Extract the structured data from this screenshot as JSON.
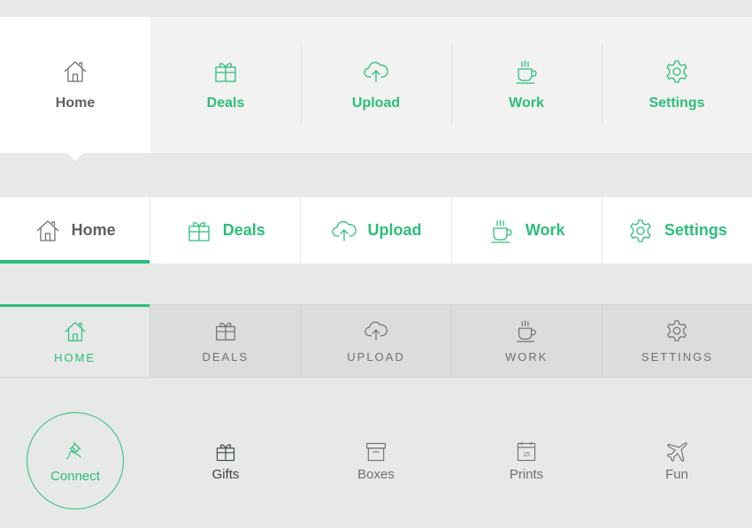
{
  "colors": {
    "accent": "#2ebd7a",
    "text_dark": "#5c6260",
    "text_muted": "#6c7270",
    "background": "#e6e9e8"
  },
  "nav1": {
    "items": [
      {
        "label": "Home",
        "icon": "home-icon",
        "active": true
      },
      {
        "label": "Deals",
        "icon": "gift-icon"
      },
      {
        "label": "Upload",
        "icon": "cloud-upload-icon"
      },
      {
        "label": "Work",
        "icon": "coffee-cup-icon"
      },
      {
        "label": "Settings",
        "icon": "gear-icon"
      }
    ]
  },
  "nav2": {
    "items": [
      {
        "label": "Home",
        "icon": "home-icon",
        "active": true
      },
      {
        "label": "Deals",
        "icon": "gift-icon"
      },
      {
        "label": "Upload",
        "icon": "cloud-upload-icon"
      },
      {
        "label": "Work",
        "icon": "coffee-cup-icon"
      },
      {
        "label": "Settings",
        "icon": "gear-icon"
      }
    ]
  },
  "nav3": {
    "items": [
      {
        "label": "HOME",
        "icon": "home-icon",
        "active": true
      },
      {
        "label": "DEALS",
        "icon": "gift-icon"
      },
      {
        "label": "UPLOAD",
        "icon": "cloud-upload-icon"
      },
      {
        "label": "WORK",
        "icon": "coffee-cup-icon"
      },
      {
        "label": "SETTINGS",
        "icon": "gear-icon"
      }
    ]
  },
  "nav4": {
    "items": [
      {
        "label": "Connect",
        "icon": "plug-icon",
        "active": true
      },
      {
        "label": "Gifts",
        "icon": "gift-icon"
      },
      {
        "label": "Boxes",
        "icon": "box-icon"
      },
      {
        "label": "Prints",
        "icon": "calendar-icon",
        "calendar_day": "15"
      },
      {
        "label": "Fun",
        "icon": "airplane-icon"
      }
    ]
  }
}
